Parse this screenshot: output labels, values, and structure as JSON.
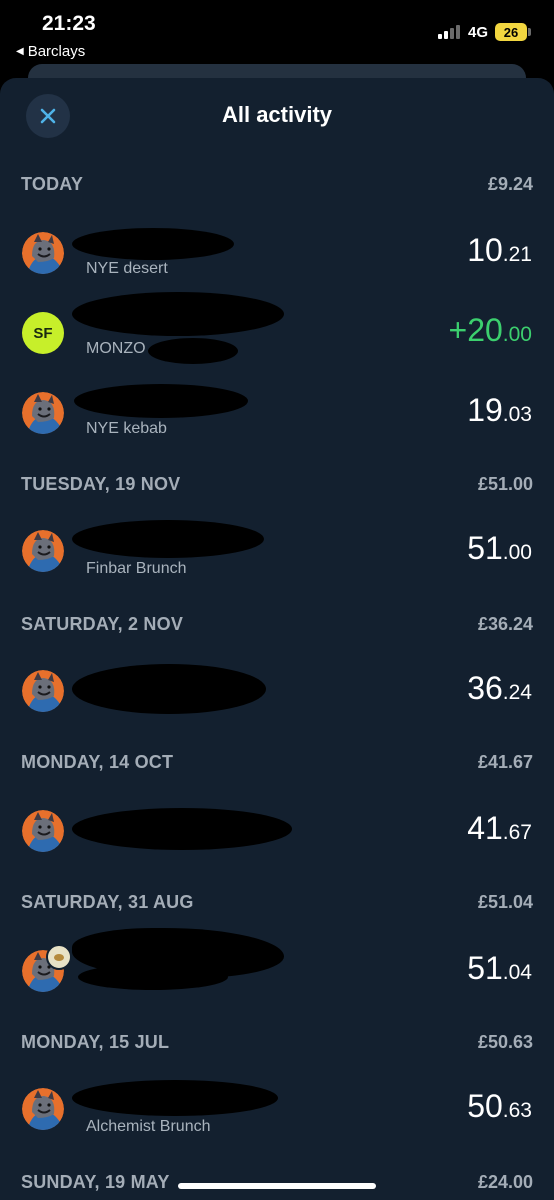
{
  "status_bar": {
    "time": "21:23",
    "back_app": "Barclays",
    "network": "4G",
    "battery": "26"
  },
  "sheet": {
    "title": "All activity",
    "close_icon": "close-icon"
  },
  "sections": [
    {
      "date": "TODAY",
      "total": "£9.24",
      "transactions": [
        {
          "subtitle": "NYE desert",
          "amount_major": "10",
          "amount_minor": ".21",
          "avatar": "character-avatar"
        },
        {
          "subtitle": "MONZO",
          "amount_major": "+20",
          "amount_minor": ".00",
          "avatar": "initials-avatar",
          "initials": "SF",
          "credit": true
        },
        {
          "subtitle": "NYE kebab",
          "amount_major": "19",
          "amount_minor": ".03",
          "avatar": "character-avatar"
        }
      ]
    },
    {
      "date": "TUESDAY, 19 NOV",
      "total": "£51.00",
      "transactions": [
        {
          "subtitle": "Finbar Brunch",
          "amount_major": "51",
          "amount_minor": ".00",
          "avatar": "character-avatar"
        }
      ]
    },
    {
      "date": "SATURDAY, 2 NOV",
      "total": "£36.24",
      "transactions": [
        {
          "subtitle": "",
          "amount_major": "36",
          "amount_minor": ".24",
          "avatar": "character-avatar"
        }
      ]
    },
    {
      "date": "MONDAY, 14 OCT",
      "total": "£41.67",
      "transactions": [
        {
          "subtitle": "",
          "amount_major": "41",
          "amount_minor": ".67",
          "avatar": "character-avatar"
        }
      ]
    },
    {
      "date": "SATURDAY, 31 AUG",
      "total": "£51.04",
      "transactions": [
        {
          "subtitle": "",
          "amount_major": "51",
          "amount_minor": ".04",
          "avatar": "character-avatar",
          "badge": "food-emoji-icon"
        }
      ]
    },
    {
      "date": "MONDAY, 15 JUL",
      "total": "£50.63",
      "transactions": [
        {
          "subtitle": "Alchemist Brunch",
          "amount_major": "50",
          "amount_minor": ".63",
          "avatar": "character-avatar"
        }
      ]
    },
    {
      "date": "SUNDAY, 19 MAY",
      "total": "£24.00",
      "transactions": []
    }
  ],
  "colors": {
    "sheet_bg": "#13202f",
    "credit": "#3ccf6e",
    "section_text": "#a4adb7",
    "initials_avatar_bg": "#c7ef2a",
    "battery": "#f2d640"
  }
}
